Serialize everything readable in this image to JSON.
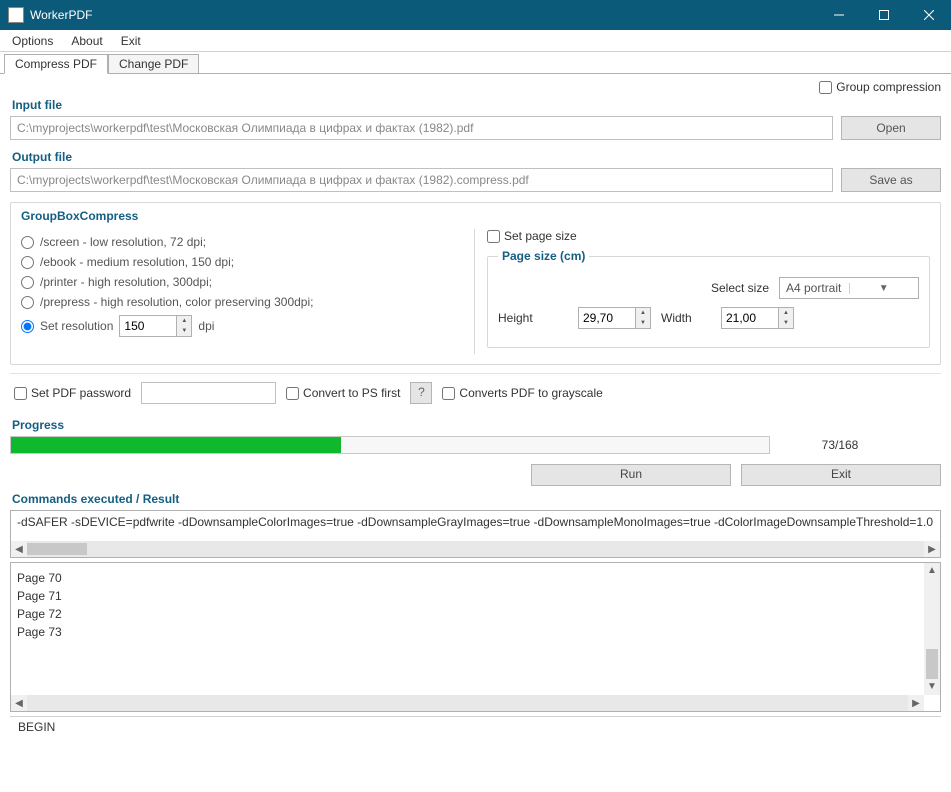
{
  "window": {
    "title": "WorkerPDF"
  },
  "menu": {
    "options": "Options",
    "about": "About",
    "exit": "Exit"
  },
  "tabs": {
    "compress": "Compress PDF",
    "change": "Change PDF"
  },
  "group_compression": {
    "label": "Group compression"
  },
  "input": {
    "label": "Input file",
    "value": "C:\\myprojects\\workerpdf\\test\\Московская Олимпиада в цифрах и фактах (1982).pdf",
    "open": "Open"
  },
  "output": {
    "label": "Output file",
    "value": "C:\\myprojects\\workerpdf\\test\\Московская Олимпиада в цифрах и фактах (1982).compress.pdf",
    "saveas": "Save as"
  },
  "compressbox": {
    "title": "GroupBoxCompress",
    "screen": "/screen - low resolution, 72 dpi;",
    "ebook": "/ebook - medium resolution, 150 dpi;",
    "printer": "/printer - high resolution, 300dpi;",
    "prepress": "/prepress - high resolution, color preserving 300dpi;",
    "setres": "Set resolution",
    "resval": "150",
    "dpi": "dpi",
    "setpagesize": "Set page size",
    "pagesizetitle": "Page size (cm)",
    "selectsize": "Select size",
    "selectedsize": "A4 portrait",
    "height": "Height",
    "heightval": "29,70",
    "width": "Width",
    "widthval": "21,00"
  },
  "options": {
    "setpwd": "Set PDF password",
    "convertps": "Convert to PS first",
    "help": "?",
    "grayscale": "Converts PDF to grayscale"
  },
  "progress": {
    "label": "Progress",
    "text": "73/168"
  },
  "buttons": {
    "run": "Run",
    "exit": "Exit"
  },
  "commands": {
    "label": "Commands executed / Result",
    "text": "-dSAFER -sDEVICE=pdfwrite -dDownsampleColorImages=true -dDownsampleGrayImages=true -dDownsampleMonoImages=true -dColorImageDownsampleThreshold=1.0"
  },
  "log": {
    "items": [
      "Page 70",
      "Page 71",
      "Page 72",
      "Page 73"
    ]
  },
  "status": "BEGIN"
}
